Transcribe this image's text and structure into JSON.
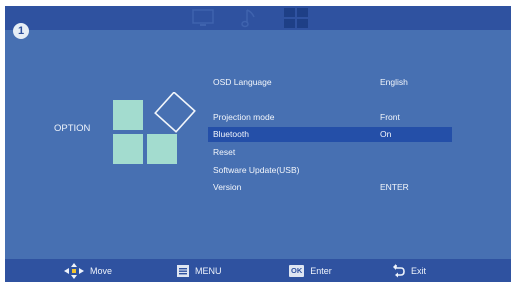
{
  "badge": "1",
  "top_tabs": [
    {
      "icon": "monitor-icon"
    },
    {
      "icon": "music-note-icon"
    },
    {
      "icon": "option-grid-icon"
    }
  ],
  "sidebar": {
    "title": "OPTION",
    "icon": "option-grid-icon"
  },
  "menu": {
    "rows": [
      {
        "label": "OSD Language",
        "value": "English"
      },
      {
        "label": "Projection mode",
        "value": "Front"
      },
      {
        "label": "Bluetooth",
        "value": "On"
      },
      {
        "label": "Reset",
        "value": ""
      },
      {
        "label": "Software Update(USB)",
        "value": ""
      },
      {
        "label": "Version",
        "value": "ENTER"
      }
    ],
    "selected_label": "Bluetooth"
  },
  "bottom_bar": {
    "move": {
      "icon": "four-way-arrow-icon",
      "label": "Move"
    },
    "menu": {
      "icon": "menu-icon",
      "label": "MENU"
    },
    "enter": {
      "key": "OK",
      "label": "Enter"
    },
    "exit": {
      "icon": "return-arrow-icon",
      "label": "Exit"
    }
  },
  "colors": {
    "background": "#4770b2",
    "bars": "#2f52a0",
    "selection": "#244fa8",
    "option_tiles": "#a3dccf"
  }
}
